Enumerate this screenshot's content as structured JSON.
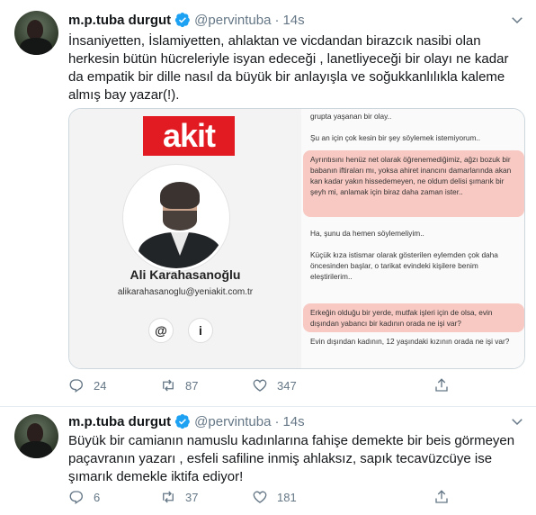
{
  "tweets": [
    {
      "author_name": "m.p.tuba durgut",
      "handle": "@pervintuba",
      "time": "14s",
      "text": "İnsaniyetten, İslamiyetten, ahlaktan ve vicdandan birazcık nasibi olan herkesin bütün hücreleriyle isyan edeceği , lanetliyeceği bir olayı ne kadar da empatik bir dille nasıl da büyük bir anlayışla ve soğukkanlılıkla kaleme almış bay yazar(!).",
      "media": {
        "logo_text": "akit",
        "columnist_name": "Ali Karahasanoğlu",
        "columnist_email": "alikarahasanoglu@yeniakit.com.tr",
        "buttons": [
          "@",
          "i"
        ],
        "paragraphs": [
          "grupta yaşanan bir olay..",
          "Şu an için çok kesin bir şey söylemek istemiyorum..",
          "Ayrıntısını henüz net olarak öğrenemediğimiz, ağzı bozuk bir babanın iftiraları mı, yoksa ahiret inancını damarlarında akan kan kadar yakın hissedemeyen, ne oldum delisi şımarık bir şeyh mi, anlamak için biraz daha zaman ister..",
          "Ha, şunu da hemen söylemeliyim..",
          "Küçük kıza istismar olarak gösterilen eylemden çok daha öncesinden başlar, o tarikat evindeki kişilere benim eleştirilerim..",
          "Erkeğin olduğu bir yerde, mutfak işleri için de olsa, evin dışından yabancı bir kadının orada ne işi var?",
          "Evin dışından kadının, 12 yaşındaki kızının orada ne işi var?"
        ]
      },
      "reply_count": "24",
      "retweet_count": "87",
      "like_count": "347"
    },
    {
      "author_name": "m.p.tuba durgut",
      "handle": "@pervintuba",
      "time": "14s",
      "text": "Büyük bir camianın namuslu kadınlarına fahişe demekte bir beis görmeyen paçavranın yazarı , esfeli safiline inmiş ahlaksız, sapık tecavüzcüye ise şımarık demekle iktifa ediyor!",
      "reply_count": "6",
      "retweet_count": "37",
      "like_count": "181"
    }
  ],
  "separator": "·",
  "colors": {
    "accent": "#1da1f2",
    "secondary_text": "#657786",
    "akit_red": "#e21b22",
    "highlight": "#f5a096"
  },
  "icons": [
    "verified-badge-icon",
    "chevron-down-icon",
    "reply-icon",
    "retweet-icon",
    "like-icon",
    "share-icon",
    "at-icon",
    "info-icon"
  ]
}
